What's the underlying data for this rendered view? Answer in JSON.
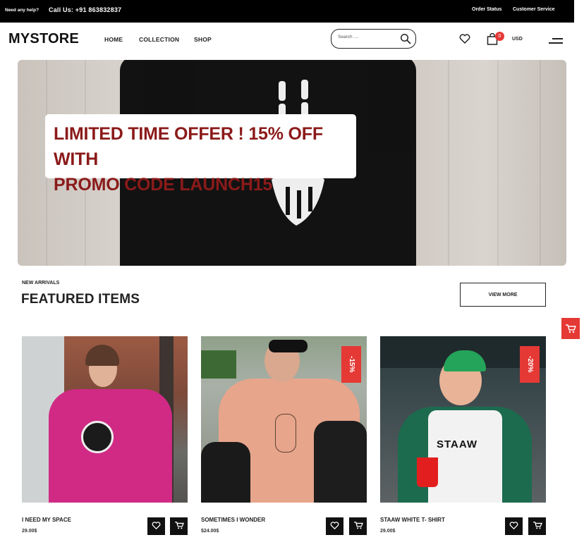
{
  "topbar": {
    "help": "Need any help?",
    "call": "Call Us: +91 863832837",
    "order_status": "Order Status",
    "customer_service": "Customer Service"
  },
  "header": {
    "logo": "MYSTORE",
    "nav": [
      "HOME",
      "COLLECTION",
      "SHOP"
    ],
    "search_placeholder": "Search ....",
    "cart_count": "0",
    "currency": "USD",
    "icons": [
      "search-icon",
      "heart-icon",
      "bag-icon",
      "menu-icon"
    ]
  },
  "hero": {
    "promo_text": "LIMITED TIME OFFER ! 15% OFF WITH\nPROMO CODE LAUNCH15",
    "promo_color": "#8b1a1a"
  },
  "section": {
    "eyebrow": "NEW ARRIVALS",
    "title": "FEATURED ITEMS",
    "view_more": "VIEW MORE"
  },
  "products": [
    {
      "name": "I NEED MY SPACE",
      "price": "29.00$",
      "badge": ""
    },
    {
      "name": "SOMETIMES I WONDER",
      "price": "$24.00$",
      "badge": "-15%"
    },
    {
      "name": "STAAW WHITE T- SHIRT",
      "price": "29.00$",
      "badge": "-20%"
    }
  ],
  "product_art": {
    "shirt3_print": "STAAW"
  },
  "colors": {
    "accent": "#e53935",
    "dark": "#111111"
  }
}
